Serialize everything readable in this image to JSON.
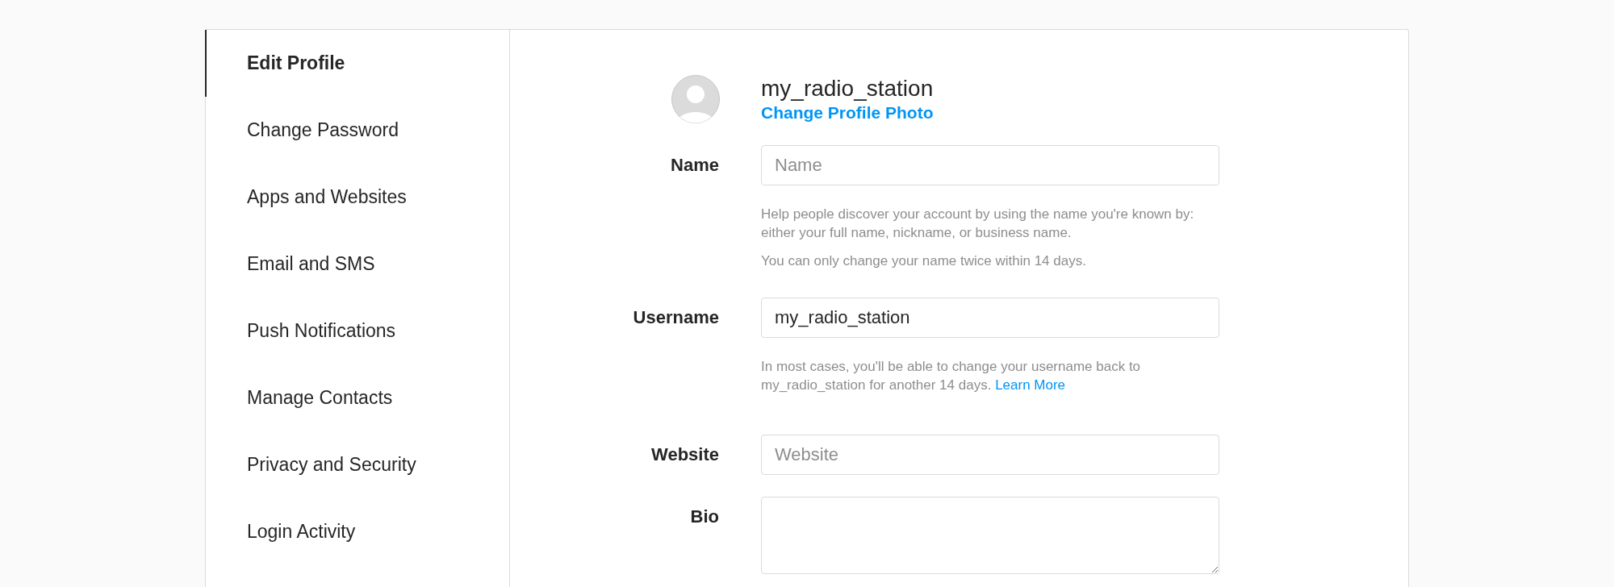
{
  "sidebar": {
    "items": [
      {
        "label": "Edit Profile",
        "selected": true
      },
      {
        "label": "Change Password",
        "selected": false
      },
      {
        "label": "Apps and Websites",
        "selected": false
      },
      {
        "label": "Email and SMS",
        "selected": false
      },
      {
        "label": "Push Notifications",
        "selected": false
      },
      {
        "label": "Manage Contacts",
        "selected": false
      },
      {
        "label": "Privacy and Security",
        "selected": false
      },
      {
        "label": "Login Activity",
        "selected": false
      }
    ]
  },
  "profile": {
    "username": "my_radio_station",
    "change_photo": "Change Profile Photo"
  },
  "fields": [
    {
      "kind": "input",
      "label": "Name",
      "placeholder": "Name",
      "hints": [
        {
          "text": "Help people discover your account by using the name you're known by: either your full name, nickname, or business name."
        },
        {
          "text": "You can only change your name twice within 14 days."
        }
      ]
    },
    {
      "kind": "input",
      "label": "Username",
      "value": "my_radio_station",
      "hints": [
        {
          "text": "In most cases, you'll be able to change your username back to my_radio_station for another 14 days.",
          "link": "Learn More"
        }
      ]
    },
    {
      "kind": "input",
      "label": "Website",
      "placeholder": "Website"
    },
    {
      "kind": "textarea",
      "label": "Bio"
    }
  ]
}
